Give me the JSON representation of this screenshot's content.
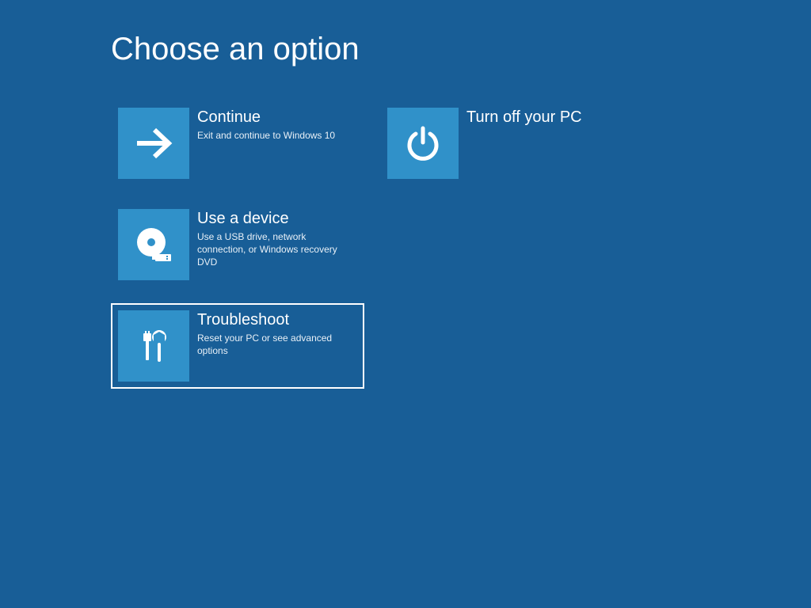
{
  "page": {
    "title": "Choose an option"
  },
  "colors": {
    "background": "#185e97",
    "tile": "#3091c9",
    "text": "#ffffff"
  },
  "options": {
    "continue": {
      "title": "Continue",
      "description": "Exit and continue to Windows 10"
    },
    "use_device": {
      "title": "Use a device",
      "description": "Use a USB drive, network connection, or Windows recovery DVD"
    },
    "troubleshoot": {
      "title": "Troubleshoot",
      "description": "Reset your PC or see advanced options"
    },
    "turn_off": {
      "title": "Turn off your PC",
      "description": ""
    }
  },
  "selected_option": "troubleshoot"
}
